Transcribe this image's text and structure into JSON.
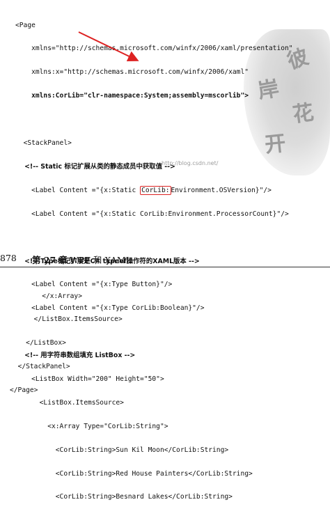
{
  "code_block_1": {
    "lines": [
      {
        "indent": "<",
        "text": "Page",
        "style": "normal"
      },
      {
        "indent": "    ",
        "text": "xmlns=\"http://schemas.microsoft.com/winfx/2006/xaml/presentation\"",
        "style": "normal"
      },
      {
        "indent": "    ",
        "text": "xmlns:x=\"http://schemas.microsoft.com/winfx/2006/xaml\"",
        "style": "normal"
      },
      {
        "indent": "    ",
        "text": "xmlns:CorLib=\"clr-namespace:System;assembly=mscorlib\">",
        "style": "bold"
      },
      {
        "indent": "",
        "text": "",
        "style": "normal"
      },
      {
        "indent": "  ",
        "text": "<StackPanel>",
        "style": "normal"
      },
      {
        "indent": "    ",
        "text": "<!-- Static 标记扩展从类的静态成员中获取值 -->",
        "style": "cn"
      },
      {
        "indent": "    ",
        "text": "<Label Content =\"{x:Static CorLib:Environment.OSVersion}\"/>",
        "style": "box"
      },
      {
        "indent": "    ",
        "text": "<Label Content =\"{x:Static CorLib:Environment.ProcessorCount}\"/>",
        "style": "normal"
      },
      {
        "indent": "",
        "text": "",
        "style": "normal"
      },
      {
        "indent": "    ",
        "text": "<!-- Type标记扩展是C# typeof操作符的XAML版本 -->",
        "style": "cn"
      },
      {
        "indent": "    ",
        "text": "<Label Content =\"{x:Type Button}\"/>",
        "style": "normal"
      },
      {
        "indent": "    ",
        "text": "<Label Content =\"{x:Type CorLib:Boolean}\"/>",
        "style": "normal"
      },
      {
        "indent": "",
        "text": "",
        "style": "normal"
      },
      {
        "indent": "    ",
        "text": "<!-- 用字符串数组填充 ListBox -->",
        "style": "cn"
      },
      {
        "indent": "    ",
        "text": "<ListBox Width=\"200\" Height=\"50\">",
        "style": "normal"
      },
      {
        "indent": "      ",
        "text": "<ListBox.ItemsSource>",
        "style": "normal"
      },
      {
        "indent": "        ",
        "text": "<x:Array Type=\"CorLib:String\">",
        "style": "normal"
      },
      {
        "indent": "          ",
        "text": "<CorLib:String>Sun Kil Moon</CorLib:String>",
        "style": "normal"
      },
      {
        "indent": "          ",
        "text": "<CorLib:String>Red House Painters</CorLib:String>",
        "style": "normal"
      },
      {
        "indent": "          ",
        "text": "<CorLib:String>Besnard Lakes</CorLib:String>",
        "style": "normal"
      }
    ]
  },
  "watermark": "http://blog.csdn.net/",
  "stamp_text": "",
  "page_header": {
    "page_number": "878",
    "chapter": "第 27 章",
    "title": "WPF 和 XAML"
  },
  "code_block_2": {
    "lines": [
      {
        "indent": "        ",
        "text": "</x:Array>"
      },
      {
        "indent": "      ",
        "text": "</ListBox.ItemsSource>"
      },
      {
        "indent": "    ",
        "text": "</ListBox>"
      },
      {
        "indent": "  ",
        "text": "</StackPanel>"
      },
      {
        "indent": "",
        "text": "</Page>"
      }
    ]
  },
  "colors": {
    "annotation": "#dd2222",
    "stamp": "#d4d4d4"
  }
}
